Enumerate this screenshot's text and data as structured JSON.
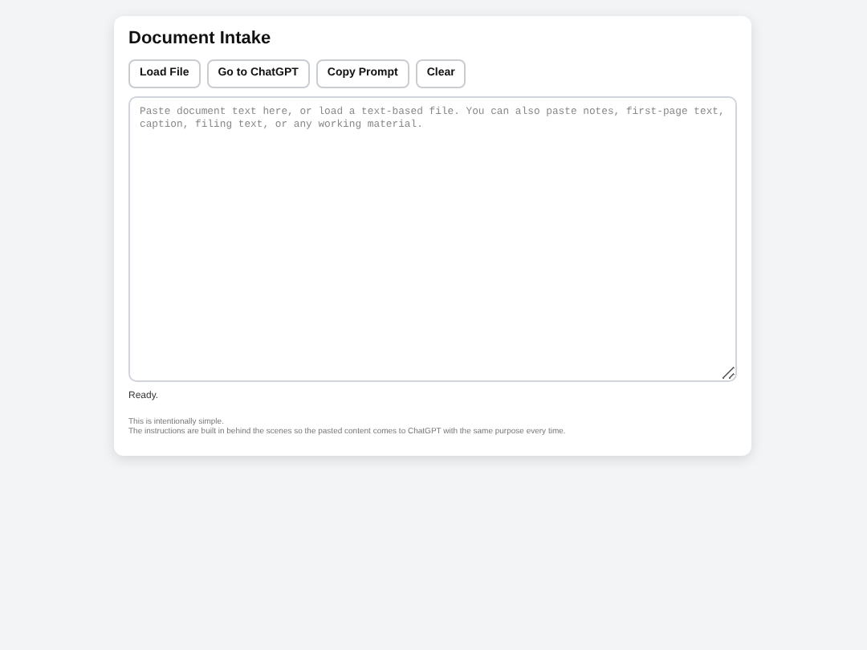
{
  "title": "Document Intake",
  "buttons": [
    "Load File",
    "Go to ChatGPT",
    "Copy Prompt",
    "Clear"
  ],
  "editor": {
    "placeholder": "Paste document text here, or load a text-based file. You can also paste notes, first-page text, caption, filing text, or any working material."
  },
  "status": "Ready.",
  "notes": [
    "This is intentionally simple.",
    "The instructions are built in behind the scenes so the pasted content comes to ChatGPT with the same purpose every time."
  ]
}
